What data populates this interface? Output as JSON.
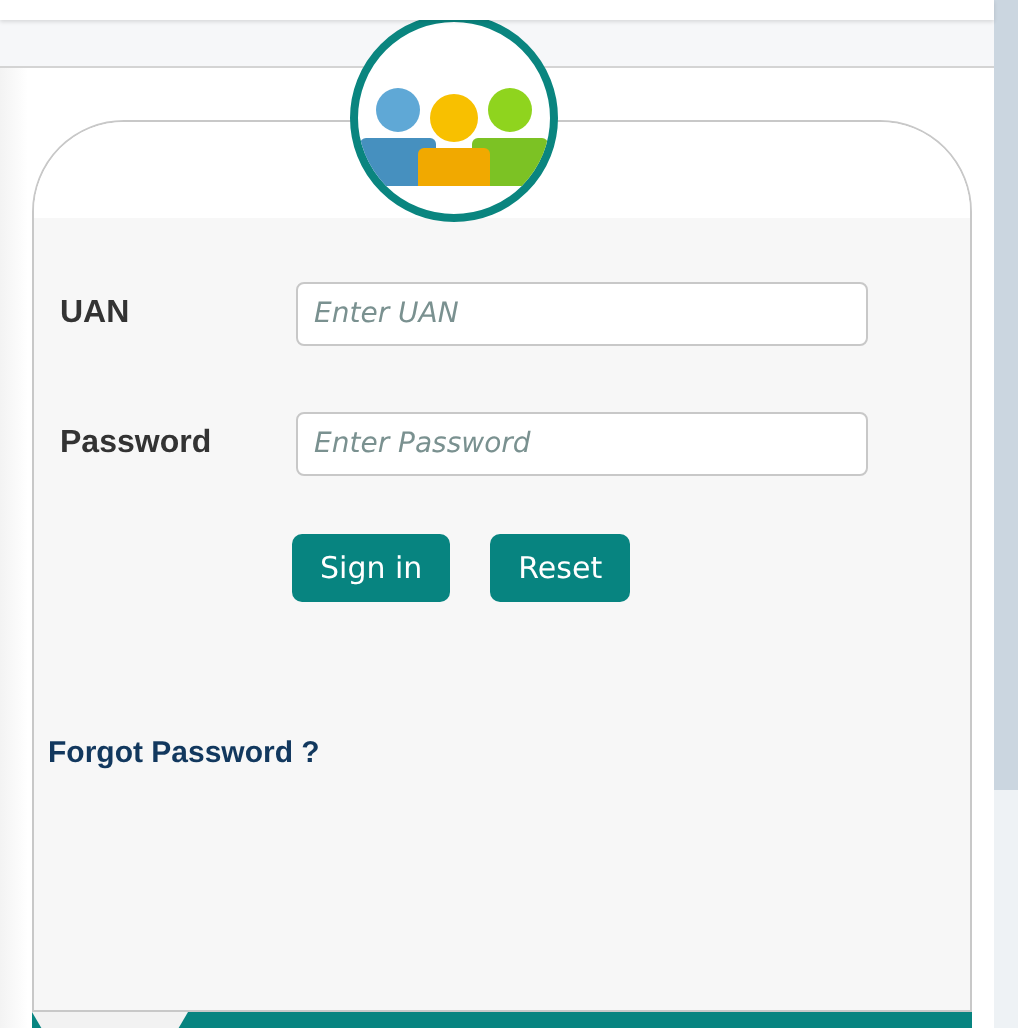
{
  "login_form": {
    "fields": [
      {
        "label": "UAN",
        "placeholder": "Enter UAN"
      },
      {
        "label": "Password",
        "placeholder": "Enter Password"
      }
    ],
    "buttons": [
      "Sign in",
      "Reset"
    ],
    "forgot_password_link": "Forgot Password ?"
  }
}
